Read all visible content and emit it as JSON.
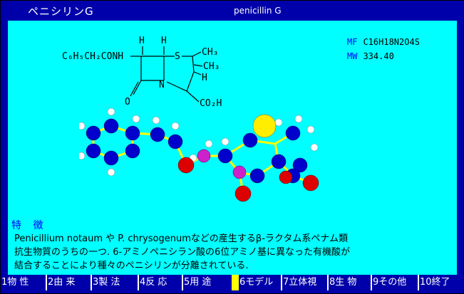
{
  "header": {
    "title_ja": "ペニシリンG",
    "title_en": "penicillin G"
  },
  "formula": {
    "mf_label": "MF",
    "mf_value": "C16H18N2O4S",
    "mw_label": "MW",
    "mw_value": "334.40"
  },
  "structure": {
    "r_group": "C₆H₅CH₂CONH",
    "h1": "H",
    "h2": "H",
    "h3": "H",
    "s": "S",
    "n": "N",
    "o": "O",
    "ch3_1": "CH₃",
    "ch3_2": "CH₃",
    "co2h": "CO₂H"
  },
  "features": {
    "heading": "特 徴",
    "line1": "Penicillium notaum や P. chrysogenumなどの産生するβ-ラクタム系ペナム類",
    "line2": "抗生物質のうちの一つ. 6-アミノペニシラン酸の6位アミノ基に異なった有機酸が",
    "line3": "結合することにより種々のペニシリンが分離されている."
  },
  "menu": [
    {
      "label": "1物 性"
    },
    {
      "label": "2由 来"
    },
    {
      "label": "3製 法"
    },
    {
      "label": "4反 応"
    },
    {
      "label": "5用 途"
    },
    {
      "label": "6モデル"
    },
    {
      "label": "7立体視"
    },
    {
      "label": "8生 物"
    },
    {
      "label": "9その他"
    },
    {
      "label": "10終了"
    }
  ],
  "colors": {
    "background": "#0000aa",
    "panel": "#00ffff",
    "carbon": "#0000cc",
    "hydrogen": "#ffffff",
    "oxygen": "#dd0000",
    "nitrogen": "#cc22cc",
    "sulfur": "#ffee00",
    "bond": "#ffff00",
    "active_menu": "#ffff00"
  }
}
